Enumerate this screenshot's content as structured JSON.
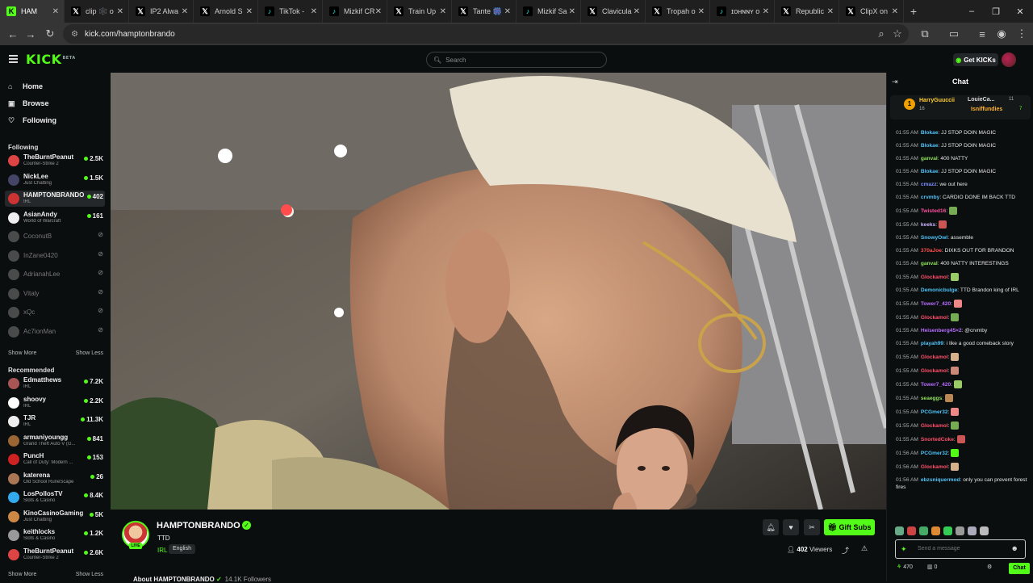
{
  "browser": {
    "tabs": [
      {
        "icon": "kick-icon",
        "title": "HAM"
      },
      {
        "icon": "x-icon",
        "title": "clip 🕸️ o"
      },
      {
        "icon": "x-icon",
        "title": "IP2 Alwa"
      },
      {
        "icon": "x-icon",
        "title": "Arnold S"
      },
      {
        "icon": "tiktok-icon",
        "title": "TikTok - "
      },
      {
        "icon": "tiktok-icon",
        "title": "Mizkif CR"
      },
      {
        "icon": "x-icon",
        "title": "Train Up"
      },
      {
        "icon": "x-icon",
        "title": "Tante 🎆"
      },
      {
        "icon": "tiktok-icon",
        "title": "Mizkif Sa"
      },
      {
        "icon": "x-icon",
        "title": "Clavicula"
      },
      {
        "icon": "x-icon",
        "title": "Tropah o"
      },
      {
        "icon": "tiktok-icon",
        "title": "ɪᴏʜɴɴʏ o"
      },
      {
        "icon": "x-icon",
        "title": "Republic"
      },
      {
        "icon": "x-icon",
        "title": "ClipX on"
      }
    ],
    "url": "kick.com/hamptonbrando"
  },
  "header": {
    "logo": "KICK",
    "logo_badge": "BETA",
    "search_placeholder": "Search",
    "get_kicks": "Get KICKs"
  },
  "sidebar": {
    "nav": [
      {
        "icon": "home-icon",
        "label": "Home"
      },
      {
        "icon": "browse-icon",
        "label": "Browse"
      },
      {
        "icon": "heart-icon",
        "label": "Following"
      }
    ],
    "following_label": "Following",
    "following": [
      {
        "name": "TheBurntPeanut",
        "category": "Counter-Strike 2",
        "viewers": "2.5K",
        "live": true,
        "color": "#d44"
      },
      {
        "name": "NickLee",
        "category": "Just Chatting",
        "viewers": "1.5K",
        "live": true,
        "color": "#446"
      },
      {
        "name": "HAMPTONBRANDO",
        "category": "IRL",
        "viewers": "402",
        "live": true,
        "color": "#c33"
      },
      {
        "name": "AsianAndy",
        "category": "World of Warcraft",
        "viewers": "161",
        "live": true,
        "color": "#eee"
      },
      {
        "name": "CoconutB",
        "category": "",
        "viewers": "",
        "live": false,
        "color": "#888"
      },
      {
        "name": "InZane0420",
        "category": "",
        "viewers": "",
        "live": false,
        "color": "#888"
      },
      {
        "name": "AdrianahLee",
        "category": "",
        "viewers": "",
        "live": false,
        "color": "#888"
      },
      {
        "name": "Vitaly",
        "category": "",
        "viewers": "",
        "live": false,
        "color": "#888"
      },
      {
        "name": "xQc",
        "category": "",
        "viewers": "",
        "live": false,
        "color": "#888"
      },
      {
        "name": "Ac7ionMan",
        "category": "",
        "viewers": "",
        "live": false,
        "color": "#888"
      }
    ],
    "show_more": "Show More",
    "show_less": "Show Less",
    "recommended_label": "Recommended",
    "recommended": [
      {
        "name": "Edmatthews",
        "category": "IRL",
        "viewers": "7.2K",
        "color": "#a55"
      },
      {
        "name": "shoovy",
        "category": "IRL",
        "viewers": "2.2K",
        "color": "#fff"
      },
      {
        "name": "TJR",
        "category": "IRL",
        "viewers": "11.3K",
        "color": "#eee"
      },
      {
        "name": "armaniyoungg",
        "category": "Grand Theft Auto V (G...",
        "viewers": "841",
        "color": "#963"
      },
      {
        "name": "PuncH",
        "category": "Call of Duty: Modern ...",
        "viewers": "153",
        "color": "#c22"
      },
      {
        "name": "katerena",
        "category": "Old School RuneScape",
        "viewers": "26",
        "color": "#a75"
      },
      {
        "name": "LosPollosTV",
        "category": "Slots & Casino",
        "viewers": "8.4K",
        "color": "#3ae"
      },
      {
        "name": "KinoCasinoGaming",
        "category": "Just Chatting",
        "viewers": "5K",
        "color": "#c84"
      },
      {
        "name": "keithlocks",
        "category": "Slots & Casino",
        "viewers": "1.2K",
        "color": "#999"
      },
      {
        "name": "TheBurntPeanut",
        "category": "Counter-Strike 2",
        "viewers": "2.6K",
        "color": "#d44"
      }
    ]
  },
  "stream": {
    "streamer": "HAMPTONBRANDO",
    "title": "TTD",
    "category": "IRL",
    "language": "English",
    "live_badge": "LIVE",
    "viewers": "402",
    "viewers_label": "Viewers",
    "gift_subs": "Gift Subs",
    "about": "About HAMPTONBRANDO",
    "followers": "14.1K Followers"
  },
  "chat": {
    "title": "Chat",
    "pinned": {
      "rank": "1",
      "user1": "HarryGuuccii",
      "user1_count": "16",
      "user2": "LouieCa...",
      "user2_count": "11",
      "user3": "Isniffundies",
      "user3_count": "7"
    },
    "messages": [
      {
        "time": "01:55 AM",
        "user": "Blokae",
        "color": "#4fc3f7",
        "text": "JJ STOP DOIN MAGIC"
      },
      {
        "time": "01:55 AM",
        "user": "Blokae",
        "color": "#4fc3f7",
        "text": "JJ STOP DOIN MAGIC"
      },
      {
        "time": "01:55 AM",
        "user": "ganval",
        "color": "#8ee05a",
        "text": "400 NATTY"
      },
      {
        "time": "01:55 AM",
        "user": "Blokae",
        "color": "#4fc3f7",
        "text": "JJ STOP DOIN MAGIC"
      },
      {
        "time": "01:55 AM",
        "user": "cmazz",
        "color": "#7c8cff",
        "text": "we out here"
      },
      {
        "time": "01:55 AM",
        "user": "crvmby",
        "color": "#4fc3f7",
        "text": "CARDIO DONE IM BACK TTD"
      },
      {
        "time": "01:55 AM",
        "user": "Twisted16",
        "color": "#ff4fa0",
        "text": ""
      },
      {
        "time": "01:55 AM",
        "user": "keeks",
        "color": "#c9b3ff",
        "text": ""
      },
      {
        "time": "01:55 AM",
        "user": "SnowyOwl",
        "color": "#4fc3f7",
        "text": "assemble"
      },
      {
        "time": "01:55 AM",
        "user": "370aJoe",
        "color": "#ff4f4f",
        "text": "DIXKS OUT FOR BRANDON"
      },
      {
        "time": "01:55 AM",
        "user": "ganval",
        "color": "#8ee05a",
        "text": "400 NATTY INTERESTINGS"
      },
      {
        "time": "01:55 AM",
        "user": "Glockamol",
        "color": "#ff4f6a",
        "text": ""
      },
      {
        "time": "01:55 AM",
        "user": "Demonicbulge",
        "color": "#4fc3f7",
        "text": "TTD Brandon king of IRL"
      },
      {
        "time": "01:55 AM",
        "user": "Tower7_420",
        "color": "#b76cff",
        "text": ""
      },
      {
        "time": "01:55 AM",
        "user": "Glockamol",
        "color": "#ff4f6a",
        "text": ""
      },
      {
        "time": "01:55 AM",
        "user": "Heisenberg45×2",
        "color": "#b76cff",
        "text": "@crvmby"
      },
      {
        "time": "01:55 AM",
        "user": "playah99",
        "color": "#4fc3f7",
        "text": "i like a good comeback story"
      },
      {
        "time": "01:55 AM",
        "user": "Glockamol",
        "color": "#ff4f6a",
        "text": ""
      },
      {
        "time": "01:55 AM",
        "user": "Glockamol",
        "color": "#ff4f6a",
        "text": ""
      },
      {
        "time": "01:55 AM",
        "user": "Tower7_420",
        "color": "#b76cff",
        "text": ""
      },
      {
        "time": "01:55 AM",
        "user": "seaeggs",
        "color": "#8ee05a",
        "text": ""
      },
      {
        "time": "01:55 AM",
        "user": "PCGmer32",
        "color": "#4fc3f7",
        "text": ""
      },
      {
        "time": "01:55 AM",
        "user": "Glockamol",
        "color": "#ff4f6a",
        "text": ""
      },
      {
        "time": "01:55 AM",
        "user": "SnortedCoke",
        "color": "#ff4f6a",
        "text": ""
      },
      {
        "time": "01:56 AM",
        "user": "PCGmer32",
        "color": "#4fc3f7",
        "text": ""
      },
      {
        "time": "01:56 AM",
        "user": "Glockamol",
        "color": "#ff4f6a",
        "text": ""
      },
      {
        "time": "01:56 AM",
        "user": "ebzsniquermod",
        "color": "#4fc3f7",
        "text": "only you can prevent forest fires"
      }
    ],
    "input_placeholder": "Send a message",
    "kicks_count": "470",
    "subs_count": "0",
    "send_label": "Chat"
  },
  "colors": {
    "accent": "#53fc18",
    "background": "#0b0e0f",
    "panel": "#24282b"
  }
}
